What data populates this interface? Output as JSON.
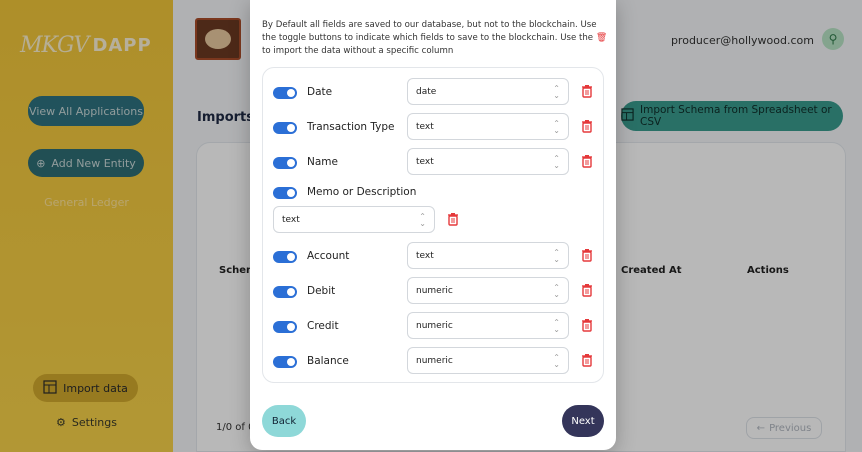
{
  "sidebar": {
    "logo_script": "MKGV",
    "logo_dapp": "DAPP",
    "view_all": "View All Applications",
    "add_entity": "Add New Entity",
    "general_ledger": "General Ledger",
    "import_data": "Import data",
    "settings": "Settings"
  },
  "header": {
    "user_email": "producer@hollywood.com"
  },
  "main": {
    "title": "Imports",
    "import_schema_btn": "Import Schema from Spreadsheet or CSV",
    "col_schema": "Schem",
    "col_created": "Created At",
    "col_actions": "Actions",
    "pagination": "1/0 of 0",
    "previous": "Previous"
  },
  "modal": {
    "description_pre": "By Default all fields are saved to our database, but not to the blockchain. Use the toggle buttons to indicate which fields to save to the blockchain. Use the",
    "description_post": "to import the data without a specific column",
    "fields": [
      {
        "label": "Date",
        "type": "date"
      },
      {
        "label": "Transaction Type",
        "type": "text"
      },
      {
        "label": "Name",
        "type": "text"
      },
      {
        "label": "Memo or Description",
        "type": "text"
      },
      {
        "label": "Account",
        "type": "text"
      },
      {
        "label": "Debit",
        "type": "numeric"
      },
      {
        "label": "Credit",
        "type": "numeric"
      },
      {
        "label": "Balance",
        "type": "numeric"
      }
    ],
    "back": "Back",
    "next": "Next"
  },
  "colors": {
    "sidebar_yellow": "#f2c63a",
    "teal": "#3a9c8e",
    "toggle_blue": "#2b6fd6",
    "trash_red": "#e5393b",
    "next_navy": "#34355a",
    "back_cyan": "#8ed8d8"
  },
  "icons": [
    "add-circle-icon",
    "import-table-icon",
    "gear-icon",
    "user-icon",
    "trash-icon",
    "chevron-updown-icon",
    "arrow-left-icon"
  ]
}
